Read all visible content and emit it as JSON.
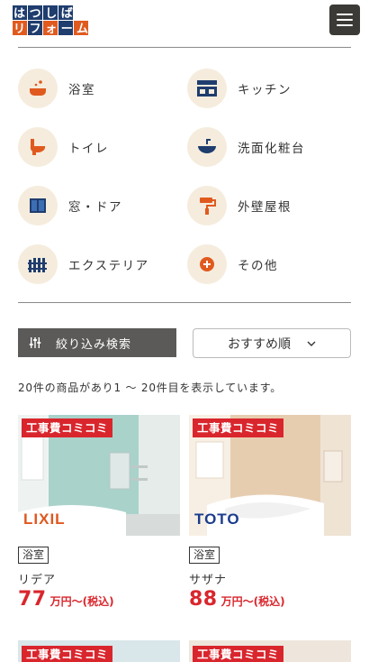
{
  "header": {
    "logo_line1": "はつしば",
    "logo_line2": "リフォーム",
    "menu_icon": "hamburger-menu-icon"
  },
  "categories": [
    {
      "label": "浴室",
      "icon": "bathtub-icon"
    },
    {
      "label": "キッチン",
      "icon": "kitchen-icon"
    },
    {
      "label": "トイレ",
      "icon": "toilet-icon"
    },
    {
      "label": "洗面化粧台",
      "icon": "washbasin-icon"
    },
    {
      "label": "窓・ドア",
      "icon": "window-icon"
    },
    {
      "label": "外壁屋根",
      "icon": "paint-roller-icon"
    },
    {
      "label": "エクステリア",
      "icon": "fence-icon"
    },
    {
      "label": "その他",
      "icon": "plus-circle-icon"
    }
  ],
  "filter": {
    "search_label": "絞り込み検索",
    "sort_label": "おすすめ順"
  },
  "result_text": "20件の商品があり1 〜 20件目を表示しています。",
  "products": [
    {
      "ribbon": "工事費コミコミ",
      "brand": "LIXIL",
      "brand_color": "#e0561e",
      "tag": "浴室",
      "name": "リデア",
      "price": "77",
      "price_unit": "万円〜(税込)"
    },
    {
      "ribbon": "工事費コミコミ",
      "brand": "TOTO",
      "brand_color": "#1a3c8c",
      "tag": "浴室",
      "name": "サザナ",
      "price": "88",
      "price_unit": "万円〜(税込)"
    }
  ],
  "next_row": [
    {
      "ribbon": "工事費コミコミ"
    },
    {
      "ribbon": "工事費コミコミ"
    }
  ],
  "colors": {
    "accent_red": "#d9262d",
    "icon_orange": "#e05a1f",
    "icon_navy": "#1f3d6e",
    "circle_bg": "#f5ecdd"
  }
}
